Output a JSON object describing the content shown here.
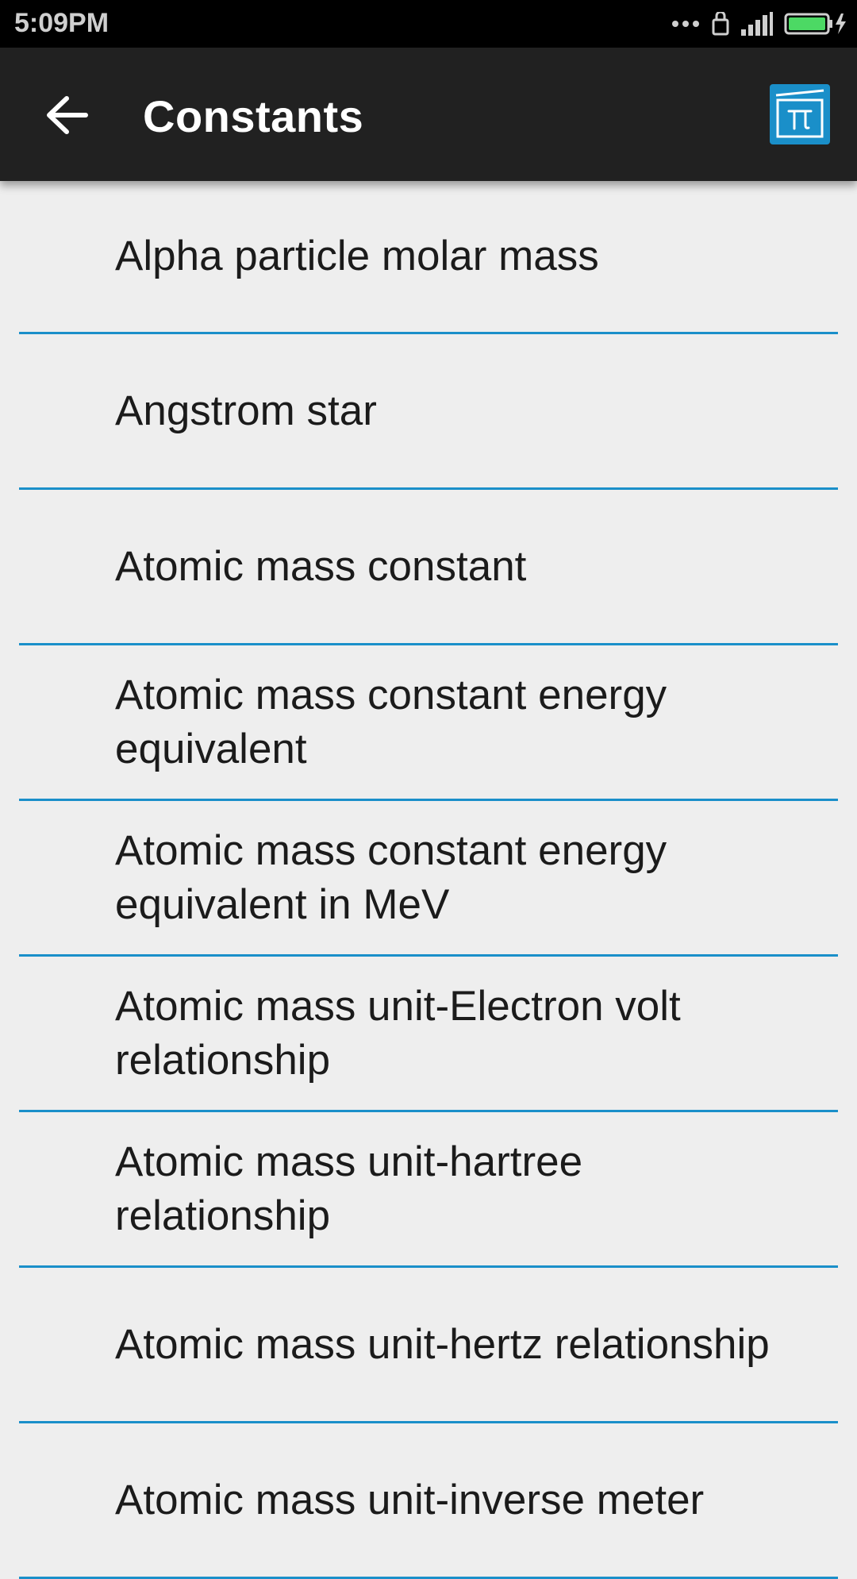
{
  "status_bar": {
    "time": "5:09PM",
    "icons": [
      "more-dots-icon",
      "sim-lock-icon",
      "signal-icon",
      "battery-charging-icon"
    ],
    "battery_color": "#4cd964"
  },
  "toolbar": {
    "back_icon": "arrow-back-icon",
    "title": "Constants",
    "action_icon": "pi-icon",
    "accent_color": "#1a8fc9"
  },
  "constants": [
    {
      "label": "Alpha particle molar mass"
    },
    {
      "label": "Angstrom star"
    },
    {
      "label": "Atomic mass constant"
    },
    {
      "label": "Atomic mass constant energy equivalent"
    },
    {
      "label": "Atomic mass constant energy equivalent in MeV"
    },
    {
      "label": "Atomic mass unit-Electron volt relationship"
    },
    {
      "label": "Atomic mass unit-hartree relationship"
    },
    {
      "label": "Atomic mass unit-hertz relationship"
    },
    {
      "label": "Atomic mass unit-inverse meter"
    }
  ]
}
